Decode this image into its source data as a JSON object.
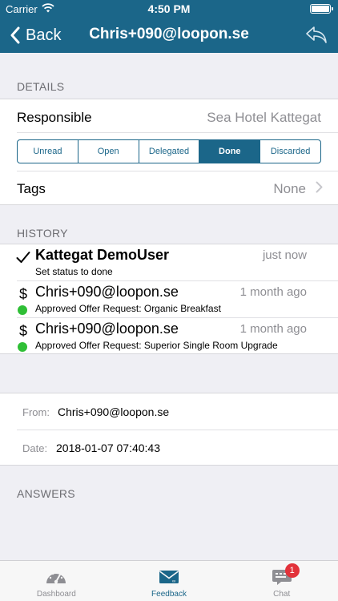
{
  "status_bar": {
    "carrier": "Carrier",
    "time": "4:50 PM"
  },
  "nav": {
    "back_label": "Back",
    "title": "Chris+090@loopon.se"
  },
  "details": {
    "header": "DETAILS",
    "responsible_label": "Responsible",
    "responsible_value": "Sea Hotel Kattegat",
    "status_options": [
      "Unread",
      "Open",
      "Delegated",
      "Done",
      "Discarded"
    ],
    "selected_status": "Done",
    "tags_label": "Tags",
    "tags_value": "None"
  },
  "history": {
    "header": "HISTORY",
    "entries": [
      {
        "icon": "checkmark-icon",
        "title": "Kattegat DemoUser",
        "time": "just now",
        "subtitle": "Set status to done"
      },
      {
        "icon": "dollar-icon",
        "title": "Chris+090@loopon.se",
        "time": "1 month ago",
        "subtitle": "Approved Offer Request: Organic Breakfast",
        "status_dot": "#2fbf36"
      },
      {
        "icon": "dollar-icon",
        "title": "Chris+090@loopon.se",
        "time": "1 month ago",
        "subtitle": "Approved Offer Request: Superior Single Room Upgrade",
        "status_dot": "#2fbf36"
      }
    ]
  },
  "message": {
    "from_label": "From:",
    "from_value": "Chris+090@loopon.se",
    "date_label": "Date:",
    "date_value": "2018-01-07 07:40:43"
  },
  "answers": {
    "header": "ANSWERS"
  },
  "tabbar": {
    "tabs": [
      {
        "label": "Dashboard",
        "icon": "gauge-icon",
        "active": false
      },
      {
        "label": "Feedback",
        "icon": "envelope-icon",
        "active": true
      },
      {
        "label": "Chat",
        "icon": "chat-bubble-icon",
        "active": false,
        "badge": "1"
      }
    ]
  },
  "colors": {
    "brand": "#1b6689",
    "background": "#efeff4",
    "success": "#2fbf36",
    "badge": "#e2323a"
  }
}
